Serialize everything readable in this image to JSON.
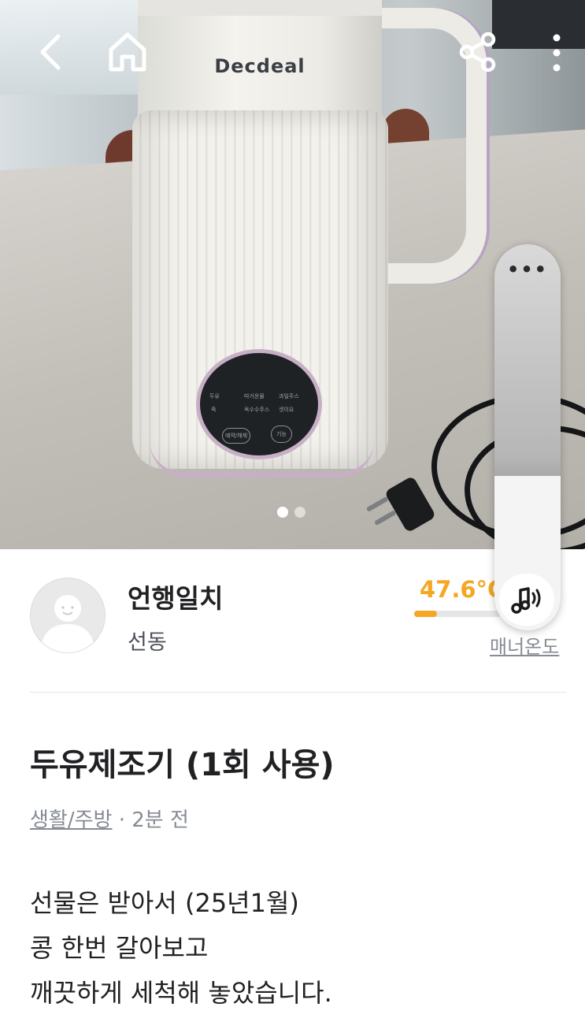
{
  "product_photo": {
    "brand_text": "Decdeal",
    "panel_labels": {
      "row1": [
        "두유",
        "따거운물",
        "과일주스"
      ],
      "row2": [
        "죽",
        "옥수수주스",
        "셋이요"
      ],
      "btn_left": "예약/해제",
      "btn_right": "기능"
    },
    "carousel": {
      "total": 2,
      "active": 1
    }
  },
  "nav": {
    "back_icon": "chevron-left-icon",
    "home_icon": "home-icon",
    "share_icon": "share-icon",
    "more_icon": "more-vertical-icon"
  },
  "floating_widget": {
    "menu_icon": "more-horizontal-icon",
    "audio_icon": "music-sound-icon",
    "level": 0.4
  },
  "seller": {
    "nickname": "언행일치",
    "location": "선동",
    "temperature": "47.6°C",
    "temperature_value": 47.6,
    "manner_label": "매너온도"
  },
  "post": {
    "title": "두유제조기 (1회 사용)",
    "category": "생활/주방",
    "time": "· 2분 전",
    "description": [
      "선물은 받아서 (25년1월)",
      "콩 한번 갈아보고",
      "깨끗하게 세척해 놓았습니다."
    ]
  },
  "colors": {
    "accent": "#f5a623",
    "text": "#212124",
    "muted": "#868b94"
  }
}
